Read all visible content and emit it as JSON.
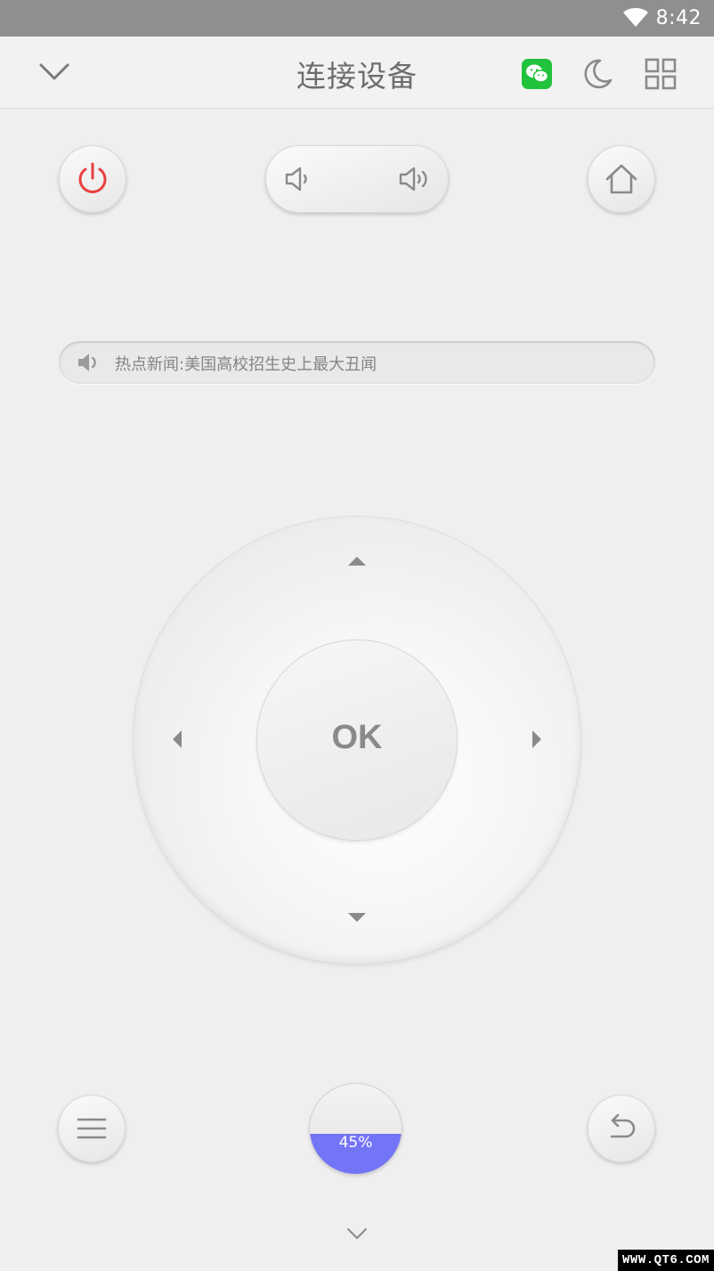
{
  "status_bar": {
    "time": "8:42",
    "wifi_icon": "wifi-icon"
  },
  "header": {
    "title": "连接设备",
    "icons": [
      "chevron-down-icon",
      "wechat-icon",
      "moon-icon",
      "grid-icon"
    ]
  },
  "controls": {
    "power_icon": "power-icon",
    "volume_down_icon": "volume-down-icon",
    "volume_up_icon": "volume-up-icon",
    "home_icon": "home-icon",
    "menu_icon": "menu-icon",
    "return_icon": "return-icon"
  },
  "news": {
    "speaker_icon": "speaker-icon",
    "text": "热点新闻:美国高校招生史上最大丑闻"
  },
  "dpad": {
    "ok_label": "OK",
    "arrows": [
      "arrow-up-icon",
      "arrow-down-icon",
      "arrow-left-icon",
      "arrow-right-icon"
    ]
  },
  "level": {
    "label": "45%",
    "value": 0.45
  },
  "colors": {
    "accent": "#7474f6",
    "power": "#e84040",
    "wechat": "#22c33c",
    "status_bar": "#8f8f8f"
  },
  "watermark": "WWW.QT6.COM"
}
